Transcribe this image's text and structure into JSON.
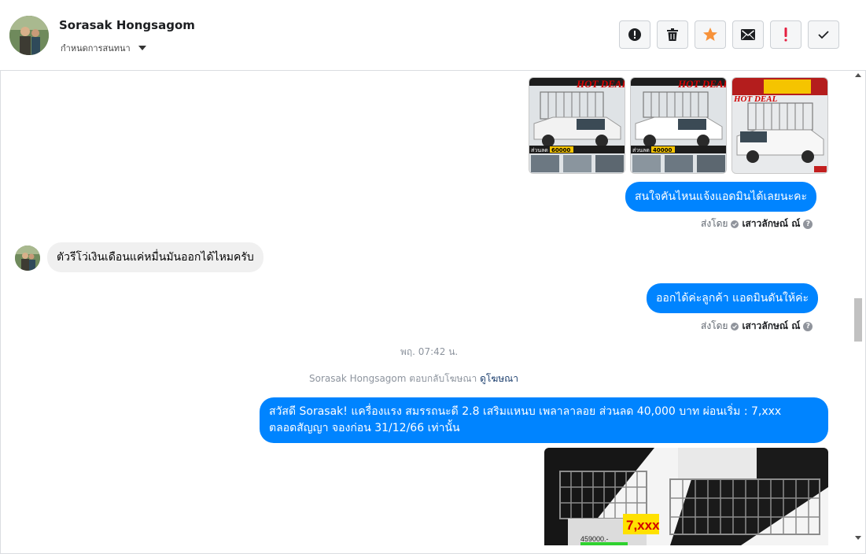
{
  "header": {
    "contact_name": "Sorasak Hongsagom",
    "settings_label": "กำหนดการสนทนา",
    "actions": [
      {
        "name": "report-icon",
        "label": "Report"
      },
      {
        "name": "trash-icon",
        "label": "Delete"
      },
      {
        "name": "star-icon",
        "label": "Star"
      },
      {
        "name": "envelope-icon",
        "label": "Mark unread"
      },
      {
        "name": "exclamation-icon",
        "label": "Spam"
      },
      {
        "name": "check-icon",
        "label": "Done"
      }
    ]
  },
  "colors": {
    "outgoing_bubble": "#0084ff",
    "incoming_bubble": "#f0f0f0",
    "star": "#f7923a",
    "spam_mark": "#e41e3f"
  },
  "messages": {
    "m1_text": "สนใจคันไหนแจ้งแอดมินได้เลยนะคะ",
    "m1_sent_by_prefix": "ส่งโดย",
    "m1_sender": "เสาวลักษณ์ ณ์",
    "m2_text": "ตัวรีโว่เงินเดือนแค่หมื่นมันออกได้ไหมครับ",
    "m3_text": "ออกได้ค่ะลูกค้า แอดมินดันให้ค่ะ",
    "m3_sent_by_prefix": "ส่งโดย",
    "m3_sender": "เสาวลักษณ์ ณ์",
    "timestamp": "พฤ. 07:42 น.",
    "ad_reply_text": "Sorasak Hongsagom ตอบกลับโฆษณา",
    "ad_reply_link": "ดูโฆษณา",
    "m4_line1": "สวัสดี Sorasak! แครื่องแรง สมรรถนะดี 2.8 เสริมแหนบ เพลาลาลอย ส่วนลด 40,000 บาท ผ่อนเริ่ม : 7,xxx",
    "m4_line2": "ตลอดสัญญา จองก่อน 31/12/66 เท่านั้น"
  },
  "promo_images": [
    {
      "badge": "HOT DEAL",
      "price": "60000"
    },
    {
      "badge": "HOT DEAL",
      "price": "40000"
    },
    {
      "badge": "HOT DEAL",
      "price": ""
    }
  ],
  "big_image": {
    "price_tag": "7,xxx",
    "old_price": "459000.-"
  }
}
